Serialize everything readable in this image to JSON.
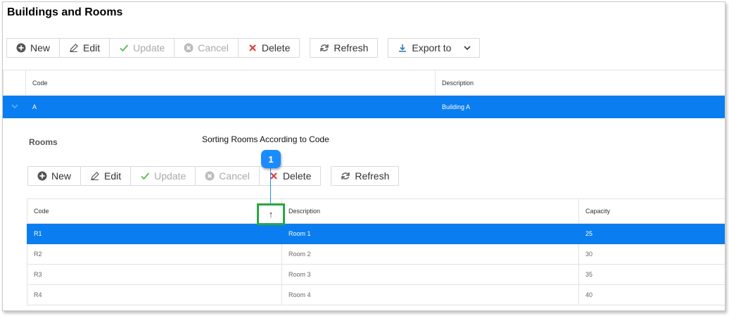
{
  "page": {
    "title": "Buildings and Rooms"
  },
  "buildings_toolbar": {
    "new_label": "New",
    "edit_label": "Edit",
    "update_label": "Update",
    "cancel_label": "Cancel",
    "delete_label": "Delete",
    "refresh_label": "Refresh",
    "export_label": "Export to"
  },
  "buildings_grid": {
    "columns": [
      "Code",
      "Description"
    ],
    "rows": [
      {
        "code": "A",
        "description": "Building A"
      }
    ]
  },
  "rooms_section": {
    "title": "Rooms"
  },
  "rooms_toolbar": {
    "new_label": "New",
    "edit_label": "Edit",
    "update_label": "Update",
    "cancel_label": "Cancel",
    "delete_label": "Delete",
    "refresh_label": "Refresh"
  },
  "rooms_grid": {
    "columns": [
      "Code",
      "Description",
      "Capacity"
    ],
    "rows": [
      {
        "code": "R1",
        "description": "Room 1",
        "capacity": "25"
      },
      {
        "code": "R2",
        "description": "Room 2",
        "capacity": "30"
      },
      {
        "code": "R3",
        "description": "Room 3",
        "capacity": "35"
      },
      {
        "code": "R4",
        "description": "Room 4",
        "capacity": "40"
      }
    ],
    "sort_indicator": "↑"
  },
  "annotation": {
    "number": "1",
    "text": "Sorting Rooms According to Code"
  },
  "colors": {
    "selection": "#0a7ef0",
    "callout": "#1a8cff",
    "highlight": "#29a744",
    "delete": "#e23b3b",
    "update": "#5cb85c"
  }
}
